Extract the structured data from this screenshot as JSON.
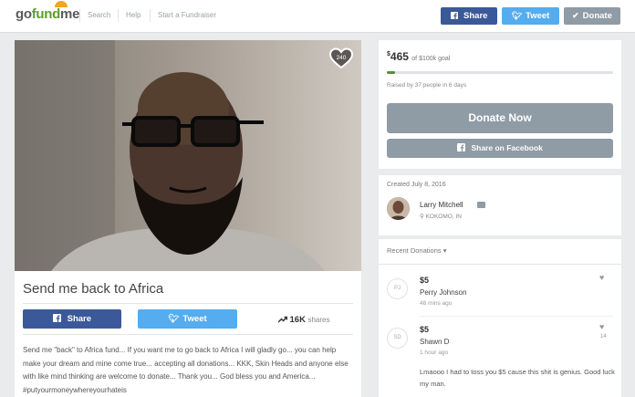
{
  "header": {
    "logo": {
      "part1": "go",
      "part2": "fund",
      "part3": "me"
    },
    "nav": [
      "Search",
      "Help",
      "Start a Fundraiser"
    ],
    "buttons": {
      "share": "Share",
      "tweet": "Tweet",
      "donate": "Donate"
    },
    "icons": {
      "share": "facebook-icon",
      "tweet": "twitter-icon",
      "donate": "checkmark-icon"
    }
  },
  "campaign": {
    "heart_count": "240",
    "title": "Send me back to Africa",
    "share_label": "Share",
    "tweet_label": "Tweet",
    "shares_count": "16K",
    "shares_label": "shares",
    "story": "Send me \"back\" to Africa fund... If you want me to go back to Africa I will gladly go... you can help make your dream and mine come true... accepting all donations... KKK, Skin Heads and anyone else with like mind thinking are welcome to donate... Thank you... God bless you and America... #putyourmoneywhereyourhateis"
  },
  "donate_box": {
    "currency": "$",
    "amount": "465",
    "goal_text": "of $100k goal",
    "progress_pct": 0.5,
    "raised_by": "Raised by 37 people in 6 days",
    "donate_now": "Donate Now",
    "share_facebook": "Share on Facebook"
  },
  "organizer": {
    "created": "Created July 8, 2016",
    "name": "Larry Mitchell",
    "location": "KOKOMO, IN"
  },
  "recent": {
    "header": "Recent Donations",
    "donations": [
      {
        "initials": "PJ",
        "amount": "$5",
        "name": "Perry Johnson",
        "time": "48 mins ago",
        "likes": ""
      },
      {
        "initials": "SD",
        "amount": "$5",
        "name": "Shawn D",
        "time": "1 hour ago",
        "likes": "14",
        "message": "Lmaooo I had to toss you $5 cause this shit is genius. Good luck my man."
      }
    ]
  },
  "colors": {
    "facebook": "#3b5998",
    "twitter": "#55acee",
    "donate_gray": "#8f9ba5",
    "brand_green": "#5d9e2c"
  }
}
